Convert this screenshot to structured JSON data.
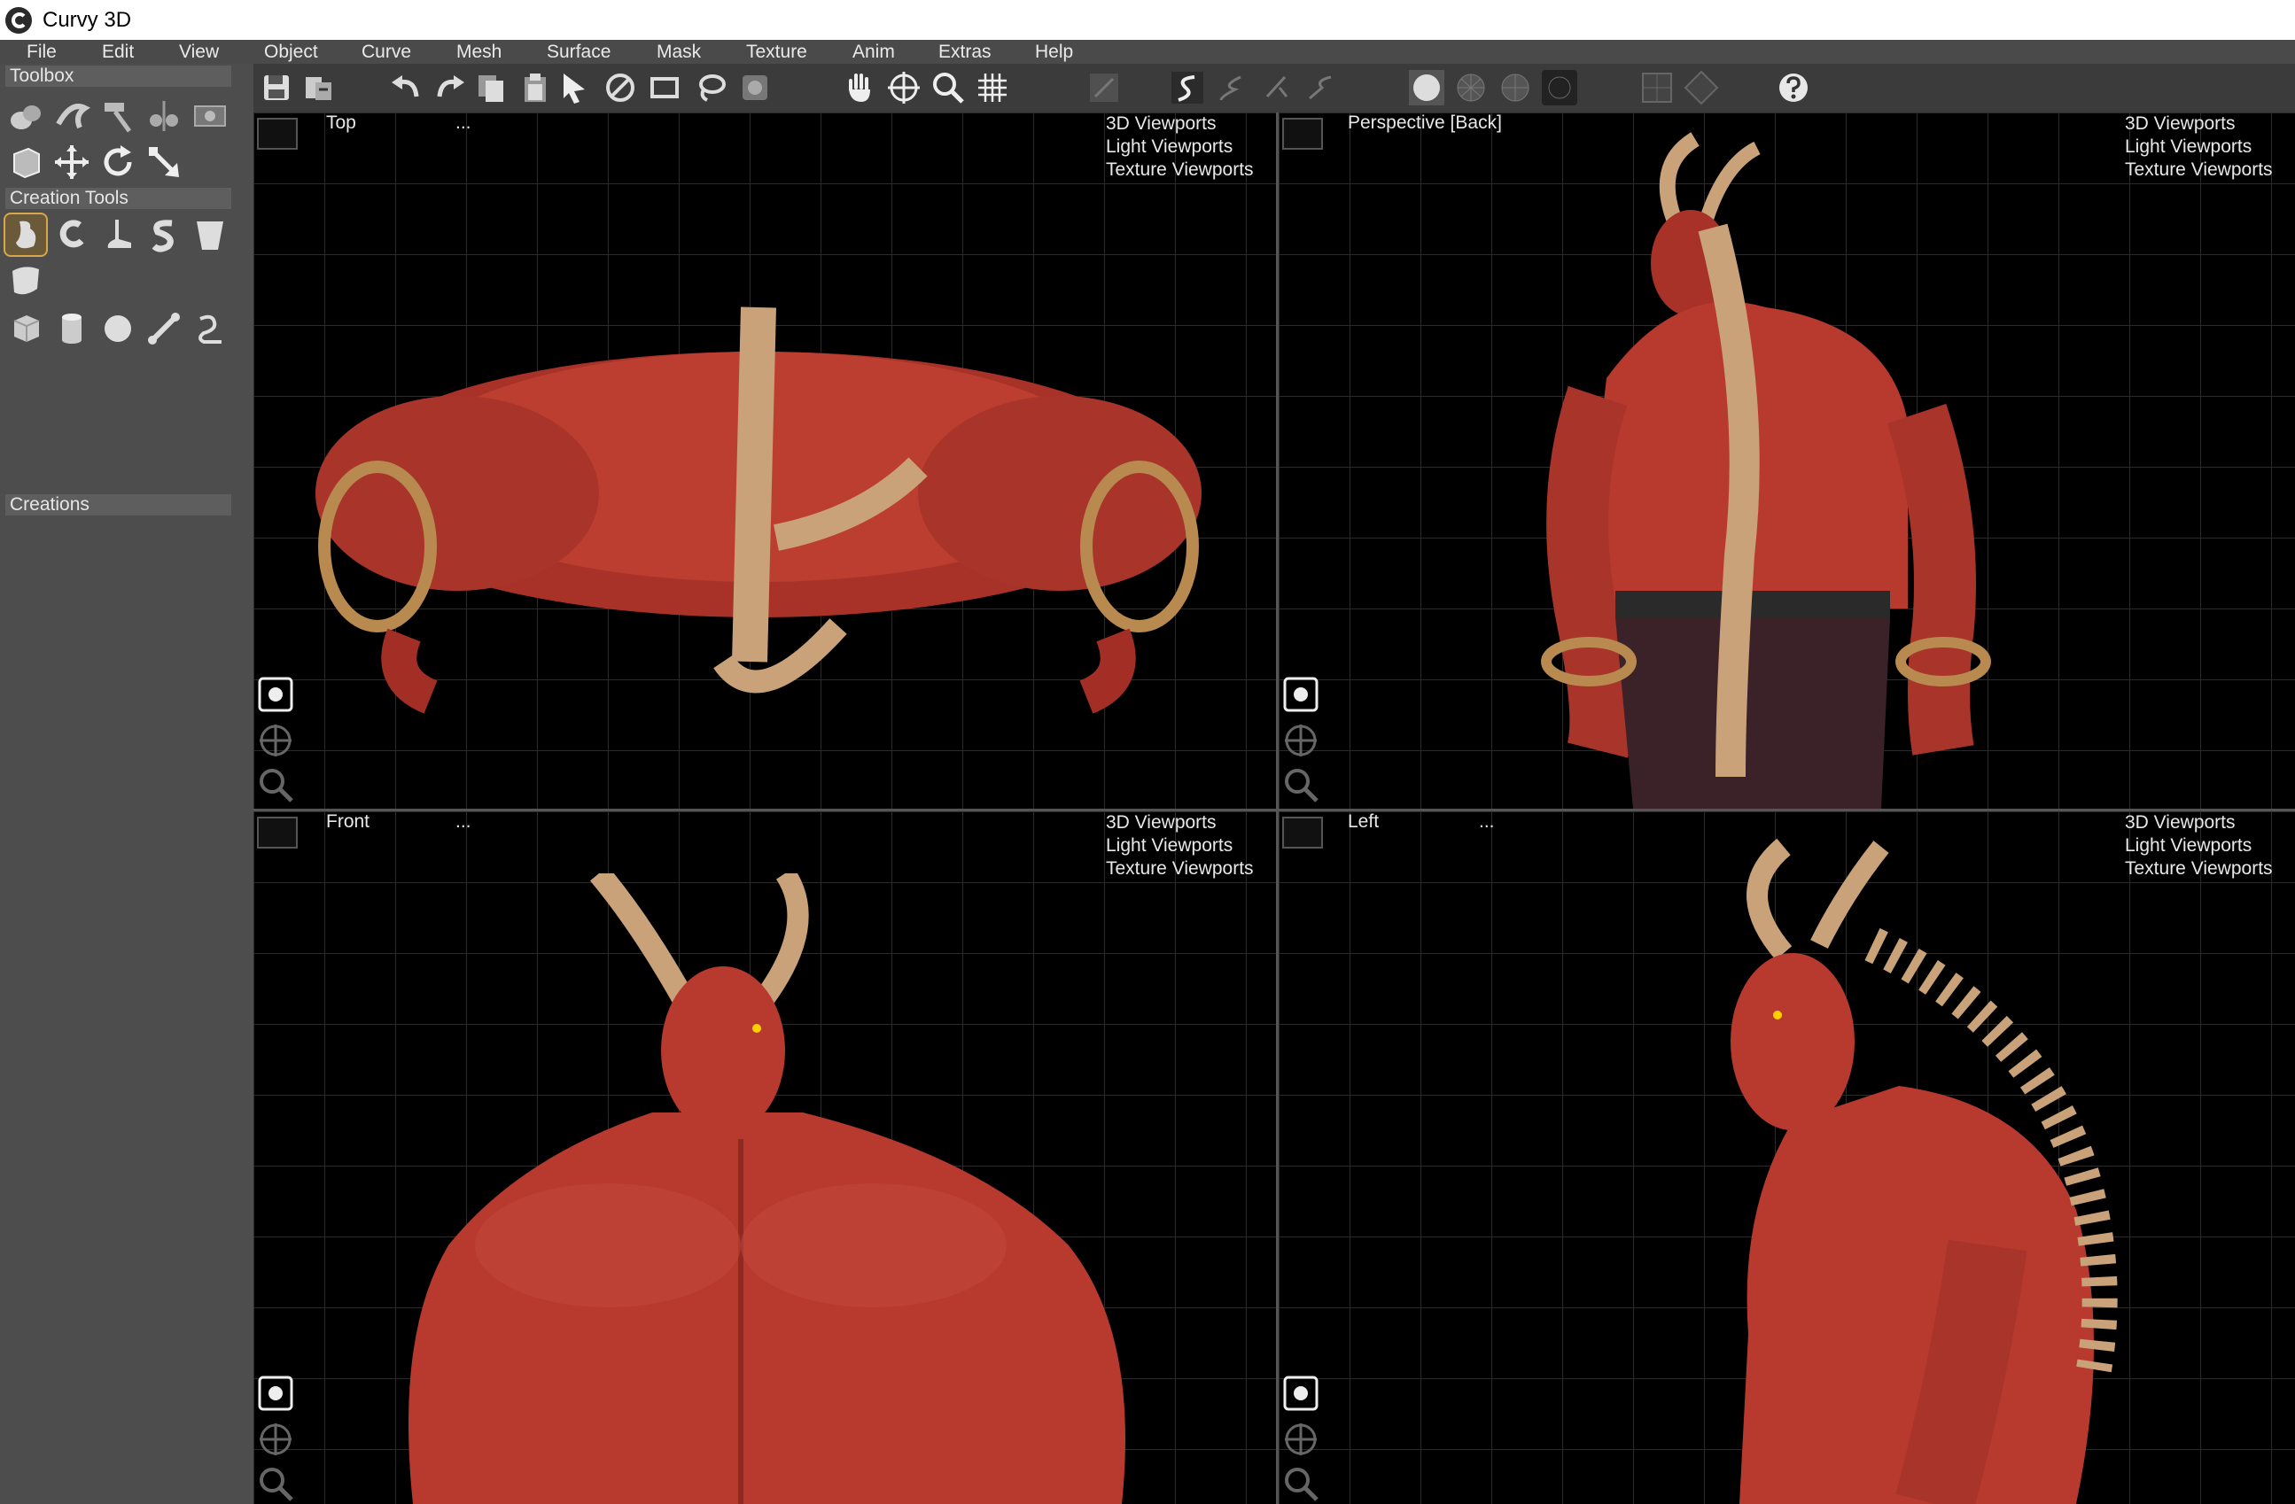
{
  "window": {
    "title": "Curvy 3D"
  },
  "menu": [
    "File",
    "Edit",
    "View",
    "Object",
    "Curve",
    "Mesh",
    "Surface",
    "Mask",
    "Texture",
    "Anim",
    "Extras",
    "Help"
  ],
  "toolbar_icons": [
    "save-icon",
    "export-icon",
    "undo-icon",
    "redo-icon",
    "copy-icon",
    "paste-icon",
    "select-arrow-icon",
    "no-select-icon",
    "rectangle-select-icon",
    "lasso-select-icon",
    "mask-icon",
    "hand-pan-icon",
    "move-icon",
    "zoom-icon",
    "grid-icon",
    "draw-disabled-icon",
    "curve-draw-icon",
    "curve-draw-2-icon",
    "curve-draw-3-icon",
    "curve-draw-4-icon",
    "shaded-sphere-icon",
    "wire-sphere-icon",
    "wire-sphere-2-icon",
    "curved-wire-icon",
    "single-view-icon",
    "quad-view-icon",
    "help-icon"
  ],
  "panels": {
    "toolbox": "Toolbox",
    "creation_tools": "Creation Tools",
    "creations": "Creations"
  },
  "viewports": {
    "top": {
      "name": "Top",
      "dots": "..."
    },
    "perspective": {
      "name": "Perspective [Back]",
      "dots": ""
    },
    "front": {
      "name": "Front",
      "dots": "..."
    },
    "left": {
      "name": "Left",
      "dots": "..."
    },
    "menu": {
      "item1": "3D Viewports",
      "item2": "Light Viewports",
      "item3": "Texture Viewports",
      "dots": "..."
    }
  },
  "colors": {
    "skin": "#b83a2e",
    "horn": "#c9a27a",
    "bracelet": "#b88a50",
    "pants": "#3a2228"
  }
}
